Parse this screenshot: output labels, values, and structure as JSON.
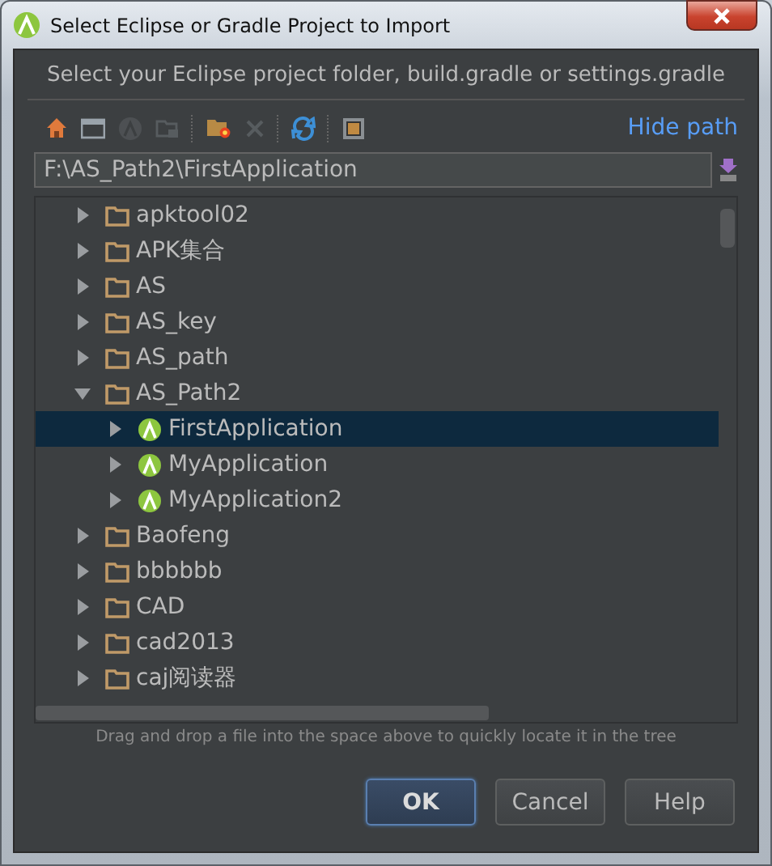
{
  "window": {
    "title": "Select Eclipse or Gradle Project to Import"
  },
  "header": "Select your Eclipse project folder, build.gradle or settings.gradle",
  "toolbar": [
    {
      "kind": "home",
      "disabled": false
    },
    {
      "kind": "desktop",
      "disabled": false
    },
    {
      "kind": "android",
      "disabled": true
    },
    {
      "kind": "module",
      "disabled": true
    },
    {
      "kind": "newfolder",
      "disabled": false
    },
    {
      "kind": "delete",
      "disabled": true
    },
    {
      "kind": "refresh",
      "disabled": false
    },
    {
      "kind": "hidden",
      "disabled": false
    }
  ],
  "hide_path": "Hide path",
  "path": "F:\\AS_Path2\\FirstApplication",
  "tree": {
    "items": [
      {
        "label": "apktool02",
        "kind": "folder",
        "expanded": false,
        "selected": false
      },
      {
        "label": "APK集合",
        "kind": "folder",
        "expanded": false,
        "selected": false
      },
      {
        "label": "AS",
        "kind": "folder",
        "expanded": false,
        "selected": false
      },
      {
        "label": "AS_key",
        "kind": "folder",
        "expanded": false,
        "selected": false
      },
      {
        "label": "AS_path",
        "kind": "folder",
        "expanded": false,
        "selected": false
      },
      {
        "label": "AS_Path2",
        "kind": "folder",
        "expanded": true,
        "selected": false,
        "children": [
          {
            "label": "FirstApplication",
            "kind": "android",
            "expanded": false,
            "selected": true
          },
          {
            "label": "MyApplication",
            "kind": "android",
            "expanded": false,
            "selected": false
          },
          {
            "label": "MyApplication2",
            "kind": "android",
            "expanded": false,
            "selected": false
          }
        ]
      },
      {
        "label": "Baofeng",
        "kind": "folder",
        "expanded": false,
        "selected": false
      },
      {
        "label": "bbbbbb",
        "kind": "folder",
        "expanded": false,
        "selected": false
      },
      {
        "label": "CAD",
        "kind": "folder",
        "expanded": false,
        "selected": false
      },
      {
        "label": "cad2013",
        "kind": "folder",
        "expanded": false,
        "selected": false
      },
      {
        "label": "caj阅读器",
        "kind": "folder",
        "expanded": false,
        "selected": false
      }
    ]
  },
  "hint": "Drag and drop a file into the space above to quickly locate it in the tree",
  "buttons": [
    {
      "label": "OK",
      "default": true
    },
    {
      "label": "Cancel",
      "default": false
    },
    {
      "label": "Help",
      "default": false
    }
  ]
}
